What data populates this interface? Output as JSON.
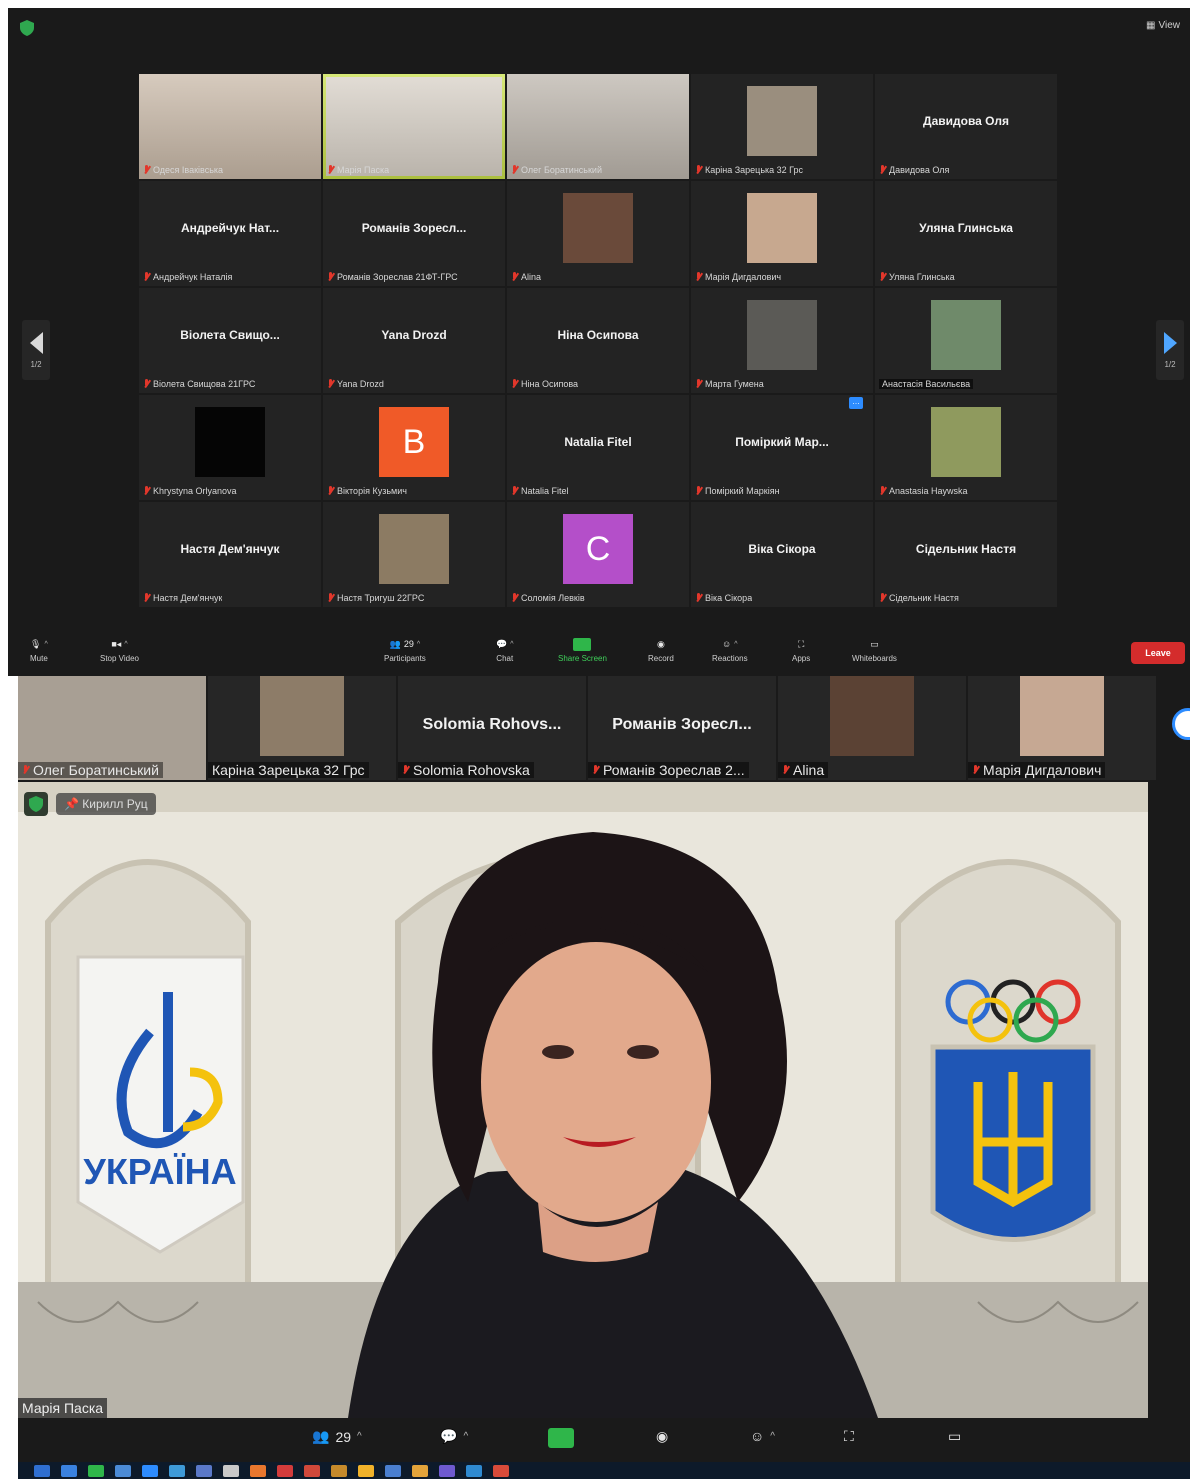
{
  "top": {
    "view_label": "View",
    "prev_page": "1/2",
    "next_page": "1/2",
    "tiles": [
      {
        "label": "Одеся Іваківська",
        "kind": "photo",
        "bg": "#c9b9a8"
      },
      {
        "label": "Марія Паска",
        "kind": "photo",
        "bg": "#d9d2c8",
        "active": true
      },
      {
        "label": "Олег Боратинський",
        "kind": "photo",
        "bg": "#bdb6ad"
      },
      {
        "label": "Каріна Зарецька 32 Грс",
        "kind": "thumb",
        "bg": "#9a8e7e"
      },
      {
        "name": "Давидова Оля",
        "label": "Давидова Оля",
        "kind": "name"
      },
      {
        "name": "Андрейчук Нат...",
        "label": "Андрейчук Наталія",
        "kind": "name"
      },
      {
        "name": "Романів Зоресл...",
        "label": "Романів Зореслав 21ФТ-ГРС",
        "kind": "name"
      },
      {
        "label": "Alina",
        "kind": "thumb",
        "bg": "#6a4a3a"
      },
      {
        "label": "Марія Дигдалович",
        "kind": "thumb",
        "bg": "#c7a88f"
      },
      {
        "name": "Уляна Глинська",
        "label": "Уляна Глинська",
        "kind": "name"
      },
      {
        "name": "Віолета Свищо...",
        "label": "Віолета Свищова 21ГРС",
        "kind": "name"
      },
      {
        "name": "Yana Drozd",
        "label": "Yana Drozd",
        "kind": "name"
      },
      {
        "name": "Ніна Осипова",
        "label": "Ніна Осипова",
        "kind": "name"
      },
      {
        "label": "Марта Гумена",
        "kind": "thumb",
        "bg": "#5b5a56"
      },
      {
        "label": "Анастасія Васильєва",
        "kind": "thumb",
        "bg": "#6f8a6a",
        "boxed": true,
        "nomic": true
      },
      {
        "label": "Khrystyna Orlyanova",
        "kind": "black"
      },
      {
        "letter": "B",
        "label": "Вікторія Кузьмич",
        "kind": "letter",
        "color": "#f05a28"
      },
      {
        "name": "Natalia Fitel",
        "label": "Natalia Fitel",
        "kind": "name"
      },
      {
        "name": "Поміркий Мар...",
        "label": "Поміркий Маркіян",
        "kind": "name",
        "chat": true
      },
      {
        "label": "Anastasia Haywska",
        "kind": "thumb",
        "bg": "#8f9a5e"
      },
      {
        "name": "Настя Дем'янчук",
        "label": "Настя Дем'янчук",
        "kind": "name"
      },
      {
        "label": "Настя Тригуш 22ГРС",
        "kind": "thumb",
        "bg": "#8c7b63"
      },
      {
        "letter": "C",
        "label": "Соломія Левків",
        "kind": "letter",
        "color": "#b44fc9"
      },
      {
        "name": "Віка Сікора",
        "label": "Віка Сікора",
        "kind": "name"
      },
      {
        "name": "Сідельник Настя",
        "label": "Сідельник Настя",
        "kind": "name"
      }
    ],
    "toolbar": {
      "mute": "Mute",
      "stop_video": "Stop Video",
      "participants": "Participants",
      "participants_count": "29",
      "chat": "Chat",
      "share_screen": "Share Screen",
      "record": "Record",
      "reactions": "Reactions",
      "apps": "Apps",
      "whiteboards": "Whiteboards",
      "leave": "Leave"
    }
  },
  "bottom": {
    "strip": [
      {
        "label": "Олег Боратинський",
        "kind": "photo",
        "bg": "#a89f94",
        "mic": true
      },
      {
        "label": "Каріна Зарецька 32 Грс",
        "kind": "thumb",
        "bg": "#8d7c68"
      },
      {
        "name": "Solomia Rohovs...",
        "label": "Solomia Rohovska",
        "kind": "name",
        "mic": true
      },
      {
        "name": "Романів Зоресл...",
        "label": "Романів Зореслав 2...",
        "kind": "name",
        "mic": true
      },
      {
        "label": "Alina",
        "kind": "thumb",
        "bg": "#5b4234",
        "mic": true
      },
      {
        "label": "Марія Дигдалович",
        "kind": "thumb",
        "bg": "#c6a893",
        "mic": true
      }
    ],
    "speaker": {
      "pinned_label": "Кирилл Руц",
      "name": "Марія Паска",
      "sign_text": "УКРАЇНА"
    },
    "toolbar": {
      "participants_count": "29"
    }
  }
}
